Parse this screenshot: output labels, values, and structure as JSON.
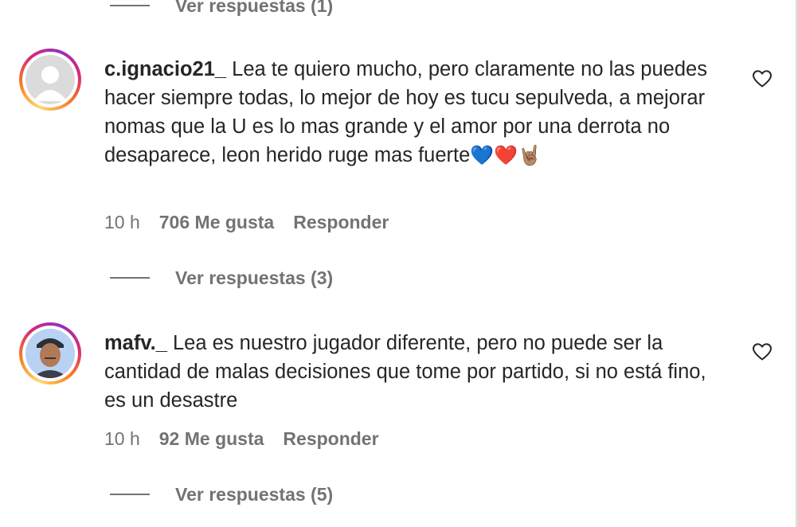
{
  "comments": [
    {
      "username": "c.ignacio21_",
      "text": "Lea te quiero mucho, pero claramente no las puedes hacer siempre todas, lo mejor de hoy es tucu sepulveda, a mejorar nomas que la U es lo mas grande y el amor por una derrota no desaparece, leon herido ruge mas fuerte",
      "emojis": "💙❤️🤘🏽",
      "time": "10 h",
      "likes": "706 Me gusta",
      "reply_label": "Responder",
      "view_replies": "Ver respuestas (3)",
      "avatar": "default-avatar-icon"
    },
    {
      "username": "mafv._",
      "text": "Lea es nuestro jugador diferente, pero no puede ser la cantidad de malas decisiones que tome por partido, si no está fino, es un desastre",
      "time": "10 h",
      "likes": "92 Me gusta",
      "reply_label": "Responder",
      "view_replies": "Ver respuestas (5)",
      "avatar": "profile-photo"
    }
  ],
  "previous_view_replies": "Ver respuestas (1)",
  "colors": {
    "text": "#262626",
    "secondary": "#737373",
    "story_ring": [
      "#feda75",
      "#fa7e1e",
      "#d62976",
      "#962fbf"
    ]
  }
}
